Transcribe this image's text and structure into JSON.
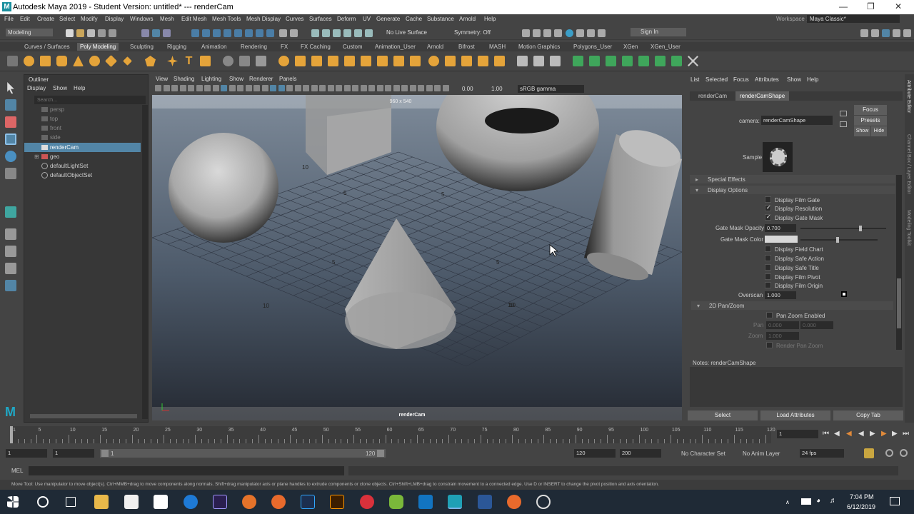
{
  "window": {
    "title": "Autodesk Maya 2019 - Student Version: untitled*   ---   renderCam",
    "logo": "M"
  },
  "menu": [
    "File",
    "Edit",
    "Create",
    "Select",
    "Modify",
    "Display",
    "Windows",
    "Mesh",
    "Edit Mesh",
    "Mesh Tools",
    "Mesh Display",
    "Curves",
    "Surfaces",
    "Deform",
    "UV",
    "Generate",
    "Cache",
    "Substance",
    "Arnold",
    "Help"
  ],
  "workspace": {
    "label": "Workspace :",
    "value": "Maya Classic*"
  },
  "statusline": {
    "mode": "Modeling",
    "live_surface": "No Live Surface",
    "symmetry": "Symmetry: Off",
    "sign_in": "Sign In"
  },
  "shelf_tabs": [
    "Curves / Surfaces",
    "Poly Modeling",
    "Sculpting",
    "Rigging",
    "Animation",
    "Rendering",
    "FX",
    "FX Caching",
    "Custom",
    "Animation_User",
    "Arnold",
    "Bifrost",
    "MASH",
    "Motion Graphics",
    "Polygons_User",
    "XGen",
    "XGen_User"
  ],
  "shelf_active": "Poly Modeling",
  "outliner": {
    "title": "Outliner",
    "menu": [
      "Display",
      "Show",
      "Help"
    ],
    "search_placeholder": "Search...",
    "items": [
      {
        "label": "persp",
        "dim": true
      },
      {
        "label": "top",
        "dim": true
      },
      {
        "label": "front",
        "dim": true
      },
      {
        "label": "side",
        "dim": true
      },
      {
        "label": "renderCam",
        "selected": true
      },
      {
        "label": "geo"
      },
      {
        "label": "defaultLightSet"
      },
      {
        "label": "defaultObjectSet"
      }
    ]
  },
  "viewport": {
    "menu": [
      "View",
      "Shading",
      "Lighting",
      "Show",
      "Renderer",
      "Panels"
    ],
    "resolution": "960 x 540",
    "camera_label": "renderCam",
    "exposure": "0.00",
    "gamma": "1.00",
    "color_space": "sRGB gamma",
    "grid_labels": [
      "10",
      "5",
      "5",
      "10",
      "5",
      "5",
      "10",
      "10"
    ]
  },
  "attribute_editor": {
    "menu": [
      "List",
      "Selected",
      "Focus",
      "Attributes",
      "Show",
      "Help"
    ],
    "tabs": [
      "renderCam",
      "renderCamShape"
    ],
    "active_tab": "renderCamShape",
    "camera_label": "camera:",
    "camera_value": "renderCamShape",
    "focus": "Focus",
    "presets": "Presets",
    "show": "Show",
    "hide": "Hide",
    "sample": "Sample",
    "sections": {
      "special_effects": "Special Effects",
      "display_options": "Display Options",
      "pan_zoom": "2D Pan/Zoom"
    },
    "display_options": [
      {
        "label": "Display Film Gate",
        "checked": false
      },
      {
        "label": "Display Resolution",
        "checked": true
      },
      {
        "label": "Display Gate Mask",
        "checked": true
      }
    ],
    "gate_mask_opacity_label": "Gate Mask Opacity",
    "gate_mask_opacity": "0.700",
    "gate_mask_color_label": "Gate Mask Color",
    "more_options": [
      {
        "label": "Display Field Chart",
        "checked": false
      },
      {
        "label": "Display Safe Action",
        "checked": false
      },
      {
        "label": "Display Safe Title",
        "checked": false
      },
      {
        "label": "Display Film Pivot",
        "checked": false
      },
      {
        "label": "Display Film Origin",
        "checked": false
      }
    ],
    "overscan_label": "Overscan",
    "overscan": "1.000",
    "pan_zoom_enabled": "Pan Zoom Enabled",
    "pan_label": "Pan",
    "pan_x": "0.000",
    "pan_y": "0.000",
    "zoom_label": "Zoom",
    "zoom": "1.000",
    "render_pan_zoom": "Render Pan Zoom",
    "notes": "Notes:  renderCamShape",
    "buttons": {
      "select": "Select",
      "load": "Load Attributes",
      "copy": "Copy Tab"
    },
    "side_tabs": [
      "Attribute Editor",
      "Channel Box / Layer Editor",
      "Modeling Toolkit"
    ]
  },
  "timeline": {
    "ticks": [
      "1",
      "5",
      "10",
      "15",
      "20",
      "25",
      "30",
      "35",
      "40",
      "45",
      "50",
      "55",
      "60",
      "65",
      "70",
      "75",
      "80",
      "85",
      "90",
      "95",
      "100",
      "105",
      "110",
      "115",
      "120"
    ],
    "current": "1"
  },
  "range": {
    "start": "1",
    "start2": "1",
    "range_start": "1",
    "range_end": "120",
    "end": "120",
    "end2": "200",
    "character_set": "No Character Set",
    "anim_layer": "No Anim Layer",
    "fps": "24 fps"
  },
  "cmdline": {
    "label": "MEL"
  },
  "helpline": "Move Tool: Use manipulator to move object(s). Ctrl+MMB+drag to move components along normals. Shift+drag manipulator axis or plane handles to extrude components or clone objects. Ctrl+Shift+LMB+drag to constrain movement to a connected edge. Use D or INSERT to change the pivot position and axis orientation.",
  "taskbar": {
    "time": "7:04 PM",
    "date": "6/12/2019"
  },
  "colors": {
    "accent": "#5285a6",
    "bg": "#444444",
    "viewport_top": "#7d8a99",
    "viewport_bottom": "#252a33"
  }
}
